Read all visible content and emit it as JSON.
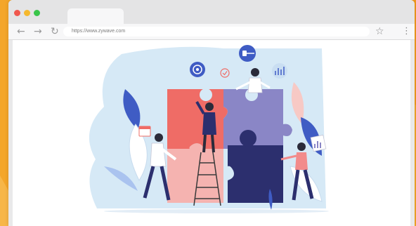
{
  "colors": {
    "page_background": "#f4a62a",
    "window_close": "#f0584e",
    "window_minimize": "#f5b82e",
    "window_maximize": "#39c54a",
    "puzzle_red": "#ef6c66",
    "puzzle_lavender": "#8a86c6",
    "puzzle_navy": "#2c2f6e",
    "puzzle_pink": "#f5b3b0",
    "backdrop_blue": "#d6e9f6"
  },
  "browser": {
    "tab_label": "",
    "url": "https://www.zywave.com",
    "icons": {
      "back": "back-arrow-icon",
      "forward": "forward-arrow-icon",
      "reload": "reload-icon",
      "bookmark": "star-icon",
      "menu": "kebab-menu-icon"
    }
  },
  "illustration": {
    "subject": "team-assembling-puzzle",
    "icons": [
      "target-icon",
      "checkmark-icon",
      "key-icon",
      "growth-chart-icon",
      "calendar-icon",
      "bar-chart-icon"
    ]
  }
}
